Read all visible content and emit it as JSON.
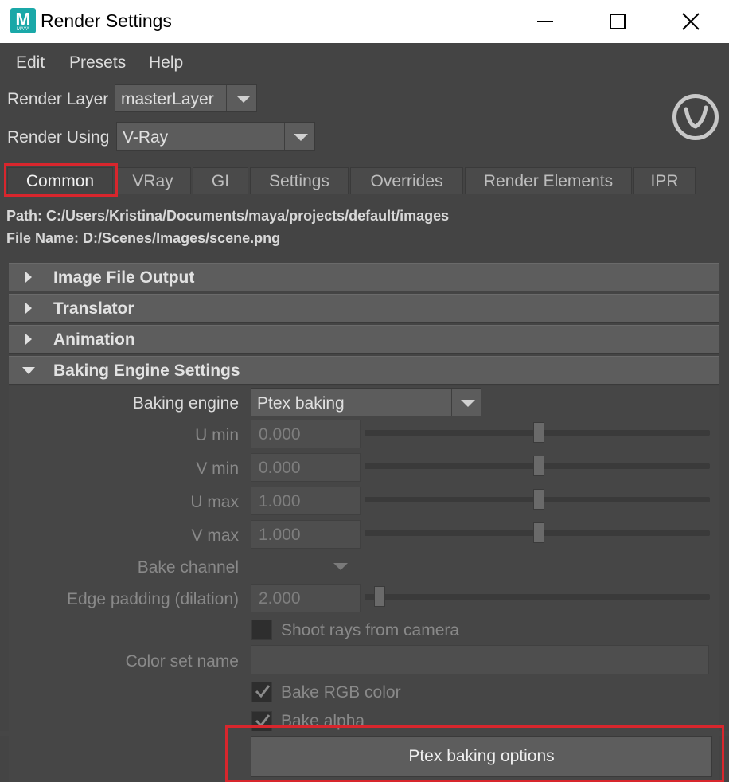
{
  "window": {
    "title": "Render Settings",
    "app_icon_letter": "M",
    "app_icon_sub": "MAYA"
  },
  "menu": [
    "Edit",
    "Presets",
    "Help"
  ],
  "render_layer": {
    "label": "Render Layer",
    "value": "masterLayer"
  },
  "render_using": {
    "label": "Render Using",
    "value": "V-Ray"
  },
  "tabs": [
    "Common",
    "VRay",
    "GI",
    "Settings",
    "Overrides",
    "Render Elements",
    "IPR"
  ],
  "active_tab": "Common",
  "paths": {
    "path": "Path: C:/Users/Kristina/Documents/maya/projects/default/images",
    "file_name": "File Name: D:/Scenes/Images/scene.png"
  },
  "sections": [
    {
      "label": "Image File Output",
      "expanded": false
    },
    {
      "label": "Translator",
      "expanded": false
    },
    {
      "label": "Animation",
      "expanded": false
    },
    {
      "label": "Baking Engine Settings",
      "expanded": true
    }
  ],
  "baking": {
    "engine_label": "Baking engine",
    "engine_value": "Ptex baking",
    "u_min": {
      "label": "U min",
      "value": "0.000",
      "slider": 0.5
    },
    "v_min": {
      "label": "V min",
      "value": "0.000",
      "slider": 0.5
    },
    "u_max": {
      "label": "U max",
      "value": "1.000",
      "slider": 0.5
    },
    "v_max": {
      "label": "V max",
      "value": "1.000",
      "slider": 0.5
    },
    "bake_channel_label": "Bake channel",
    "edge_padding": {
      "label": "Edge padding (dilation)",
      "value": "2.000",
      "slider": 0.04
    },
    "shoot_rays": {
      "label": "Shoot rays from camera",
      "checked": false
    },
    "color_set_label": "Color set name",
    "bake_rgb": {
      "label": "Bake RGB color",
      "checked": true
    },
    "bake_alpha": {
      "label": "Bake alpha",
      "checked": true
    },
    "ptex_button": "Ptex baking options"
  },
  "colors": {
    "highlight": "#d8262d",
    "background": "#444444",
    "section_header": "#5d5d5d"
  }
}
